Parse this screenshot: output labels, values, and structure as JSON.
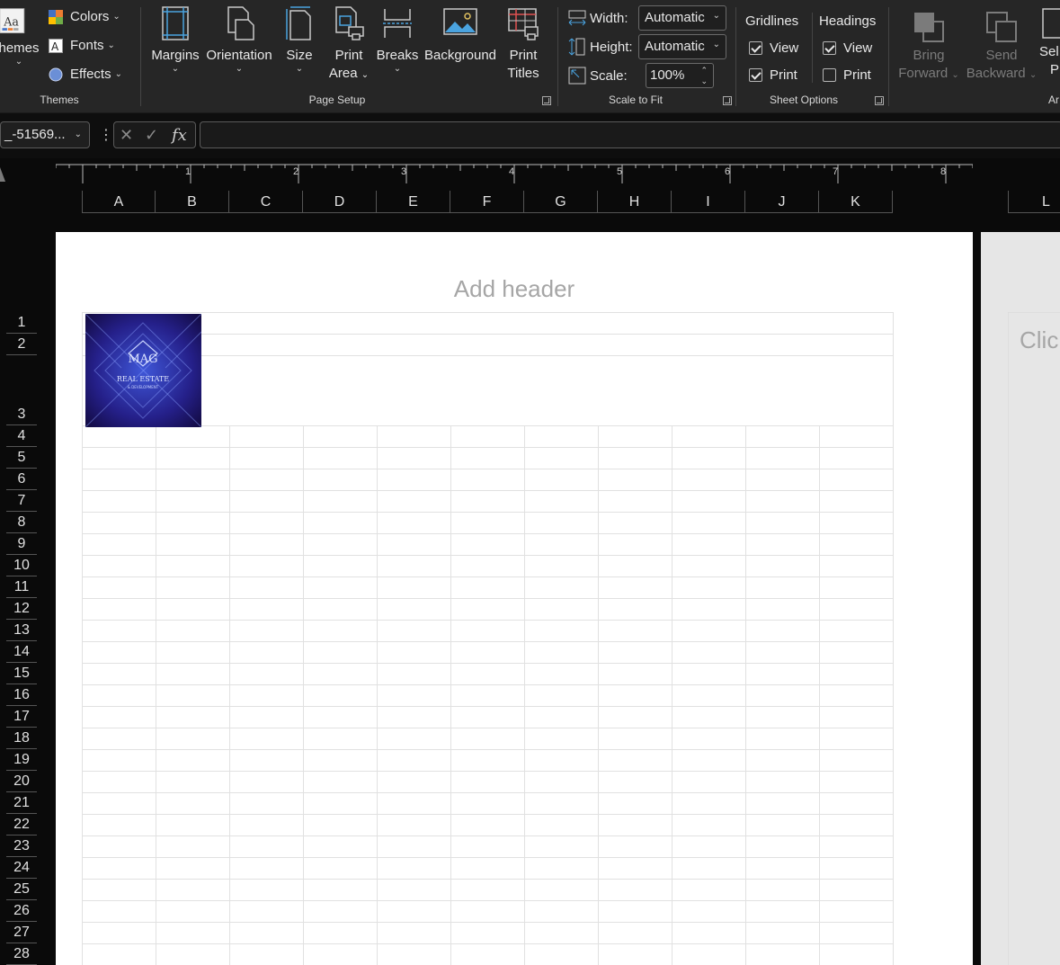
{
  "ribbon": {
    "themes_group": {
      "label": "Themes",
      "themes_button": "hemes",
      "colors": "Colors",
      "fonts": "Fonts",
      "effects": "Effects"
    },
    "page_setup_group": {
      "label": "Page Setup",
      "margins": "Margins",
      "orientation": "Orientation",
      "size": "Size",
      "print_area_l1": "Print",
      "print_area_l2": "Area",
      "breaks": "Breaks",
      "background": "Background",
      "print_titles_l1": "Print",
      "print_titles_l2": "Titles"
    },
    "scale_group": {
      "label": "Scale to Fit",
      "width_label": "Width:",
      "width_value": "Automatic",
      "height_label": "Height:",
      "height_value": "Automatic",
      "scale_label": "Scale:",
      "scale_value": "100%"
    },
    "sheet_options_group": {
      "label": "Sheet Options",
      "gridlines": "Gridlines",
      "headings": "Headings",
      "gridlines_view": {
        "label": "View",
        "checked": true
      },
      "gridlines_print": {
        "label": "Print",
        "checked": true
      },
      "headings_view": {
        "label": "View",
        "checked": true
      },
      "headings_print": {
        "label": "Print",
        "checked": false
      }
    },
    "arrange_group": {
      "label": "Ar",
      "bring_forward_l1": "Bring",
      "bring_forward_l2": "Forward",
      "send_backward_l1": "Send",
      "send_backward_l2": "Backward",
      "selection_l1": "Sel",
      "selection_l2": "P"
    }
  },
  "formula_bar": {
    "name_box": "_-51569...",
    "fx": "fx",
    "value": ""
  },
  "ruler": {
    "numbers": [
      "1",
      "2",
      "3",
      "4",
      "5",
      "6",
      "7",
      "8"
    ]
  },
  "columns": [
    "A",
    "B",
    "C",
    "D",
    "E",
    "F",
    "G",
    "H",
    "I",
    "J",
    "K",
    "L"
  ],
  "rows": [
    "1",
    "2",
    "3",
    "4",
    "5",
    "6",
    "7",
    "8",
    "9",
    "10",
    "11",
    "12",
    "13",
    "14",
    "15",
    "16",
    "17",
    "18",
    "19",
    "20",
    "21",
    "22",
    "23",
    "24",
    "25",
    "26",
    "27",
    "28"
  ],
  "page": {
    "header_placeholder": "Add header",
    "next_header_placeholder": "Clic"
  },
  "logo": {
    "text_main": "MAG",
    "text_sub": "REAL ESTATE",
    "text_sub2": "& DEVELOPMENT"
  },
  "colors": {
    "ribbon_bg": "#262626",
    "app_bg": "#0a0a0a",
    "page_bg": "#ffffff",
    "gridline": "#e1e1e1",
    "accent_blue": "#4aa3df"
  }
}
